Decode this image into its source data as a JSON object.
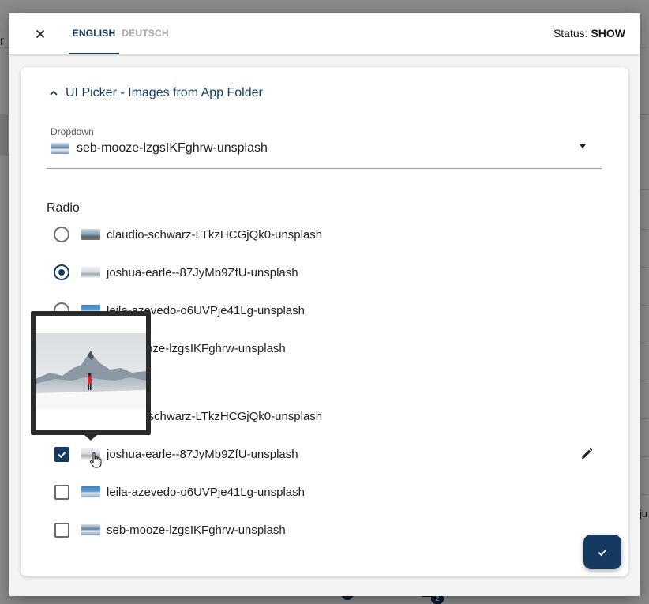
{
  "background": {
    "letter_left": "r",
    "text_right": "ju",
    "badge_count": "2"
  },
  "header": {
    "close_icon": "close-icon",
    "tabs": [
      {
        "label": "ENGLISH",
        "active": true
      },
      {
        "label": "DEUTSCH",
        "active": false
      }
    ],
    "status_label": "Status:",
    "status_value": "SHOW"
  },
  "section": {
    "title": "UI Picker - Images from App Folder",
    "expanded": true
  },
  "dropdown": {
    "label": "Dropdown",
    "value": "seb-mooze-lzgsIKFghrw-unsplash"
  },
  "radio": {
    "label": "Radio",
    "options": [
      {
        "label": "claudio-schwarz-LTkzHCGjQk0-unsplash",
        "selected": false
      },
      {
        "label": "joshua-earle--87JyMb9ZfU-unsplash",
        "selected": true
      },
      {
        "label": "leila-azevedo-o6UVPje41Lg-unsplash",
        "selected": false
      },
      {
        "label": "seb-mooze-lzgsIKFghrw-unsplash",
        "selected": false
      }
    ]
  },
  "checkbox": {
    "options": [
      {
        "label": "claudio-schwarz-LTkzHCGjQk0-unsplash",
        "checked": false
      },
      {
        "label": "joshua-earle--87JyMb9ZfU-unsplash",
        "checked": true
      },
      {
        "label": "leila-azevedo-o6UVPje41Lg-unsplash",
        "checked": false
      },
      {
        "label": "seb-mooze-lzgsIKFghrw-unsplash",
        "checked": false
      }
    ]
  },
  "colors": {
    "primary": "#163a5f",
    "tab_inactive": "#a8a8a8"
  },
  "icons": {
    "edit": "pencil-icon",
    "save": "check-icon",
    "collapse": "chevron-up-icon"
  }
}
